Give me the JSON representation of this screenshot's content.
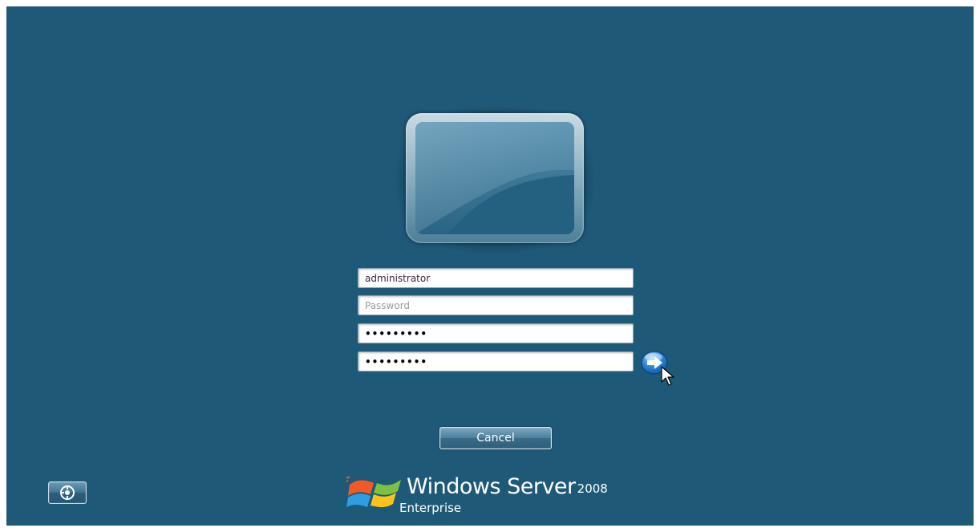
{
  "login": {
    "username_value": "administrator",
    "password_placeholder": "Password",
    "new_password_mask": "•••••••••",
    "confirm_password_mask": "•••••••••",
    "cancel_label": "Cancel"
  },
  "branding": {
    "product": "Windows Server",
    "version": "2008",
    "edition": "Enterprise"
  },
  "icons": {
    "user_tile": "user-tile-icon",
    "submit": "arrow-right-icon",
    "ease_of_access": "ease-of-access-icon",
    "logo": "windows-flag-logo",
    "cursor": "mouse-pointer-icon"
  },
  "colors": {
    "background": "#1e5a78",
    "button": "#386c89",
    "arrow": "#1a73c9"
  }
}
